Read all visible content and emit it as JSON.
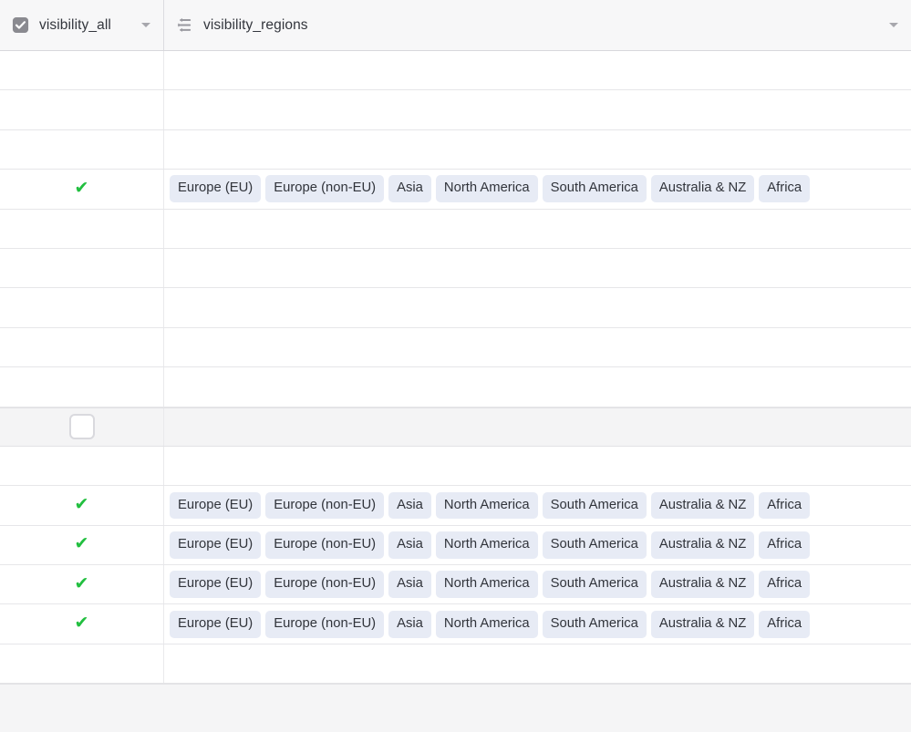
{
  "header": {
    "columns": [
      {
        "id": "visibility_all",
        "label": "visibility_all",
        "icon": "checkbox-checked-icon",
        "has_caret": true
      },
      {
        "id": "visibility_regions",
        "label": "visibility_regions",
        "icon": "multi-select-list-icon",
        "has_caret": true
      }
    ]
  },
  "glyphs": {
    "check": "✔"
  },
  "regions": [
    "Europe (EU)",
    "Europe (non-EU)",
    "Asia",
    "North America",
    "South America",
    "Australia & NZ",
    "Africa"
  ],
  "colors": {
    "tag_background": "#e7ebf5",
    "tag_text": "#31343b",
    "check_green": "#21bf3f",
    "header_background": "#f7f7f8",
    "row_selected_background": "#f4f4f5",
    "grid_line": "#e6e6e9",
    "footer_background": "#f5f5f6"
  },
  "rows": [
    {
      "index": 0,
      "all": "empty",
      "regions": "none",
      "state": "normal"
    },
    {
      "index": 1,
      "all": "empty",
      "regions": "none",
      "state": "normal"
    },
    {
      "index": 2,
      "all": "empty",
      "regions": "none",
      "state": "normal"
    },
    {
      "index": 3,
      "all": "check",
      "regions": "all",
      "state": "normal"
    },
    {
      "index": 4,
      "all": "empty",
      "regions": "none",
      "state": "normal"
    },
    {
      "index": 5,
      "all": "empty",
      "regions": "none",
      "state": "normal"
    },
    {
      "index": 6,
      "all": "empty",
      "regions": "none",
      "state": "normal"
    },
    {
      "index": 7,
      "all": "empty",
      "regions": "none",
      "state": "normal"
    },
    {
      "index": 8,
      "all": "empty",
      "regions": "none",
      "state": "normal"
    },
    {
      "index": 9,
      "all": "unchecked",
      "regions": "none",
      "state": "selected"
    },
    {
      "index": 10,
      "all": "empty",
      "regions": "none",
      "state": "normal"
    },
    {
      "index": 11,
      "all": "check",
      "regions": "all",
      "state": "normal"
    },
    {
      "index": 12,
      "all": "check",
      "regions": "all",
      "state": "normal"
    },
    {
      "index": 13,
      "all": "check",
      "regions": "all",
      "state": "normal"
    },
    {
      "index": 14,
      "all": "check",
      "regions": "all",
      "state": "normal"
    },
    {
      "index": 15,
      "all": "empty",
      "regions": "none",
      "state": "blank-tail"
    }
  ]
}
